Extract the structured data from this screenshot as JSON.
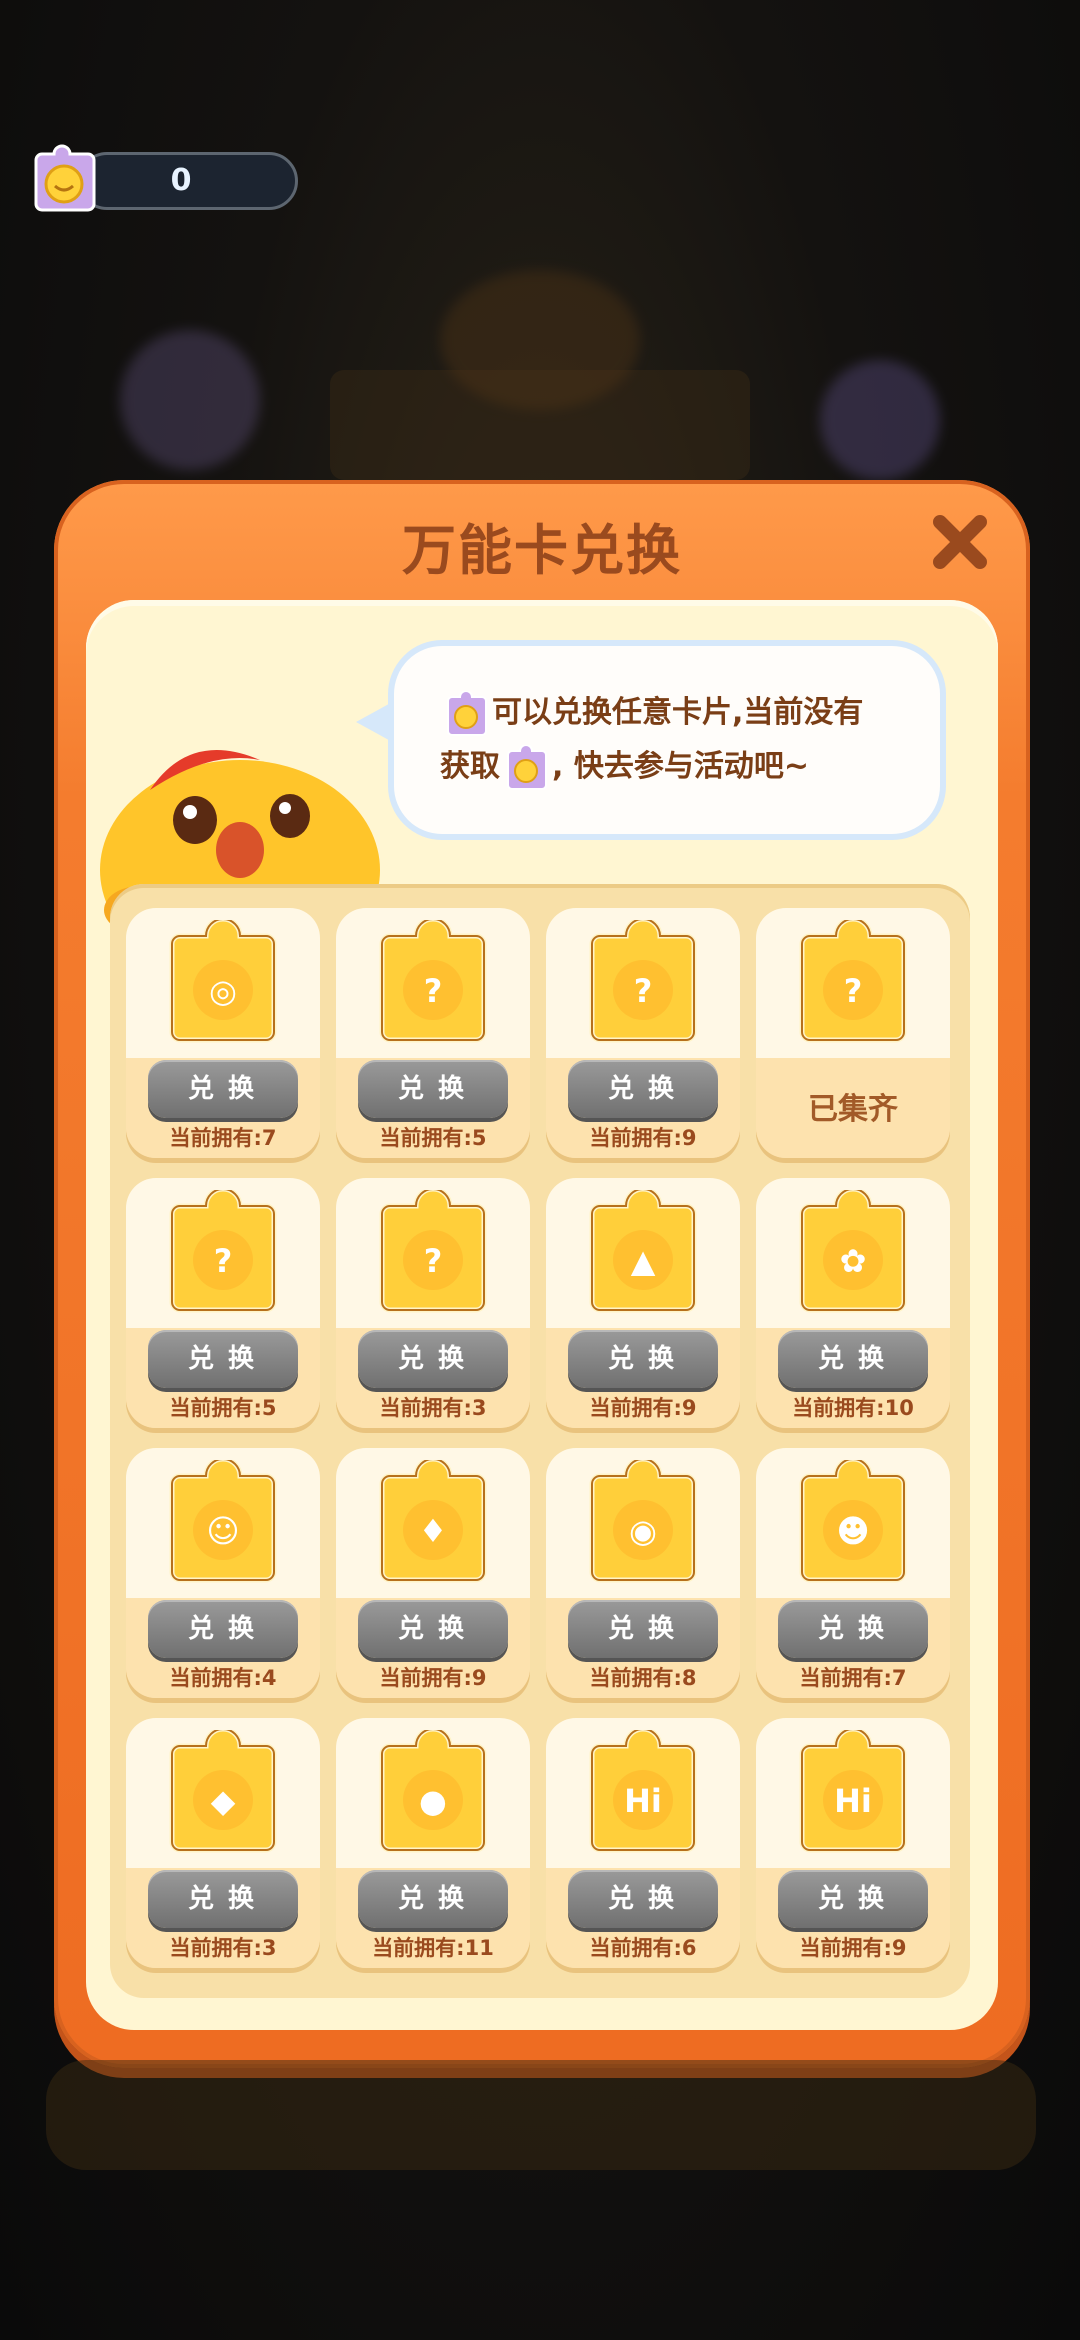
{
  "currency": {
    "value": "0",
    "icon": "universal-card-icon"
  },
  "modal": {
    "title": "万能卡兑换",
    "close_icon": "close-icon",
    "bubble": {
      "line1": "可以兑换任意卡片,当前没有",
      "line2_prefix": "获取",
      "line2_suffix": ", 快去参与活动吧~"
    }
  },
  "cards": [
    {
      "owned": "当前拥有:7",
      "button": "兑换",
      "icon": "carousel-card-icon",
      "collected": false
    },
    {
      "owned": "当前拥有:5",
      "button": "兑换",
      "icon": "wreath-bear-card-icon",
      "collected": false
    },
    {
      "owned": "当前拥有:9",
      "button": "兑换",
      "icon": "tea-stall-card-icon",
      "collected": false
    },
    {
      "owned": "",
      "button": "",
      "icon": "cow-card-icon",
      "collected": true,
      "collected_label": "已集齐"
    },
    {
      "owned": "当前拥有:5",
      "button": "兑换",
      "icon": "heart-arch-card-icon",
      "collected": false
    },
    {
      "owned": "当前拥有:3",
      "button": "兑换",
      "icon": "flower-wreath-card-icon",
      "collected": false
    },
    {
      "owned": "当前拥有:9",
      "button": "兑换",
      "icon": "pagoda-card-icon",
      "collected": false
    },
    {
      "owned": "当前拥有:10",
      "button": "兑换",
      "icon": "flower-charm-card-icon",
      "collected": false
    },
    {
      "owned": "当前拥有:4",
      "button": "兑换",
      "icon": "lucky-cat-card-icon",
      "collected": false
    },
    {
      "owned": "当前拥有:9",
      "button": "兑换",
      "icon": "chick-card-icon",
      "collected": false
    },
    {
      "owned": "当前拥有:8",
      "button": "兑换",
      "icon": "pink-fish-card-icon",
      "collected": false
    },
    {
      "owned": "当前拥有:7",
      "button": "兑换",
      "icon": "red-hat-kid-card-icon",
      "collected": false
    },
    {
      "owned": "当前拥有:3",
      "button": "兑换",
      "icon": "blue-knight-card-icon",
      "collected": false
    },
    {
      "owned": "当前拥有:11",
      "button": "兑换",
      "icon": "bear-card-icon",
      "collected": false
    },
    {
      "owned": "当前拥有:6",
      "button": "兑换",
      "icon": "hi-sign-card-icon",
      "collected": false
    },
    {
      "owned": "当前拥有:9",
      "button": "兑换",
      "icon": "hi-sign-sparkle-card-icon",
      "collected": false
    }
  ],
  "colors": {
    "modal_orange": "#f47c2e",
    "panel_cream": "#fff6d2",
    "title_brown": "#9a4a1e",
    "button_grey": "#808080"
  }
}
